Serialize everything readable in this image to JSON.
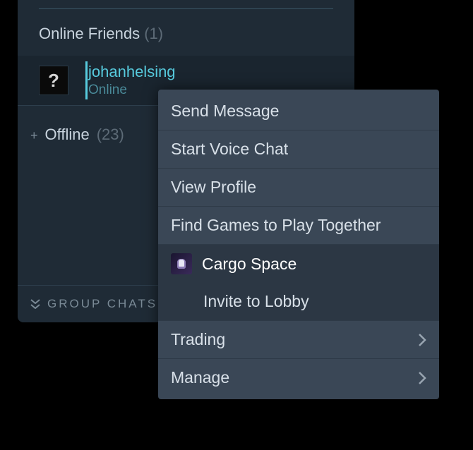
{
  "friends": {
    "online_header": "Online Friends",
    "online_count": "(1)",
    "list": [
      {
        "name": "johanhelsing",
        "status": "Online",
        "avatar_placeholder": "?"
      }
    ],
    "offline_label": "Offline",
    "offline_count": "(23)"
  },
  "group_chats_label": "GROUP CHATS",
  "context_menu": {
    "send_message": "Send Message",
    "start_voice_chat": "Start Voice Chat",
    "view_profile": "View Profile",
    "find_games": "Find Games to Play Together",
    "game_name": "Cargo Space",
    "invite_to_lobby": "Invite to Lobby",
    "trading": "Trading",
    "manage": "Manage"
  }
}
